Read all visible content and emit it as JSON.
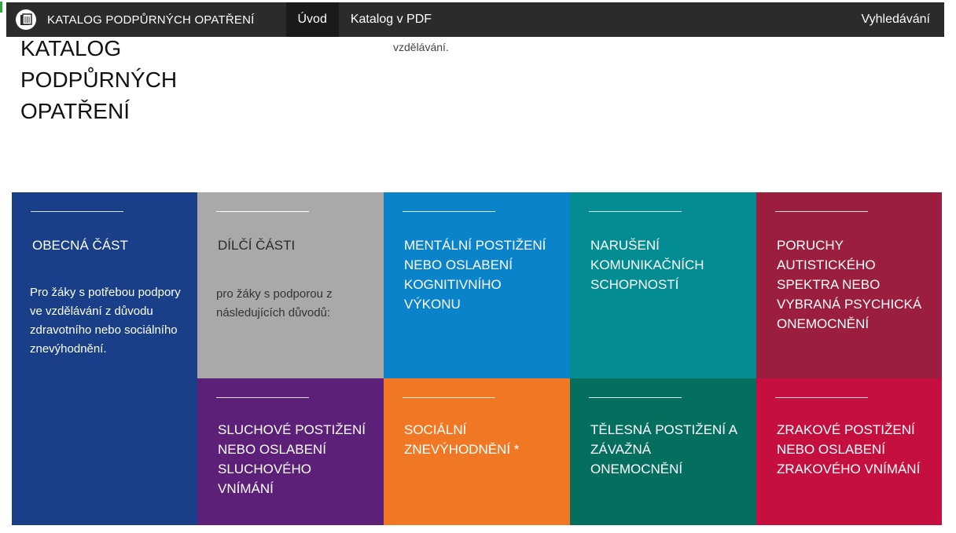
{
  "navbar": {
    "brand_title": "KATALOG PODPŮRNÝCH OPATŘENÍ",
    "brand_icon": "book-icon",
    "items": [
      {
        "label": "Úvod",
        "active": true
      },
      {
        "label": "Katalog v PDF",
        "active": false
      }
    ],
    "search_label": "Vyhledávání"
  },
  "header": {
    "title": "KATALOG PODPŮRNÝCH OPATŘENÍ",
    "intro_fragment": "vzdělávání."
  },
  "tiles": {
    "general": {
      "title": "OBECNÁ ČÁST",
      "description": "Pro žáky s potřebou podpory ve vzdělávání z důvodu zdravotního nebo sociálního znevýhodnění.",
      "color": "#183f87"
    },
    "partial": {
      "title": "DÍLČÍ ČÁSTI",
      "description": "pro žáky s podporou z následujících důvodů:",
      "color": "#a9a9a9"
    },
    "mental": {
      "title": "MENTÁLNÍ POSTIŽENÍ NEBO OSLABENÍ KOGNITIVNÍHO VÝKONU",
      "color": "#0b83cb"
    },
    "communication": {
      "title": "NARUŠENÍ KOMUNIKAČNÍCH SCHOPNOSTÍ",
      "color": "#038d92"
    },
    "autism": {
      "title": "PORUCHY AUTISTICKÉHO SPEKTRA NEBO VYBRANÁ PSYCHICKÁ ONEMOCNĚNÍ",
      "color": "#9b1e3e"
    },
    "hearing": {
      "title": "SLUCHOVÉ POSTIŽENÍ NEBO OSLABENÍ SLUCHOVÉHO VNÍMÁNÍ",
      "color": "#5c2078"
    },
    "social": {
      "title": "SOCIÁLNÍ ZNEVÝHODNĚNÍ *",
      "color": "#f07824"
    },
    "physical": {
      "title": "TĚLESNÁ POSTIŽENÍ A ZÁVAŽNÁ ONEMOCNĚNÍ",
      "color": "#056f5f"
    },
    "visual": {
      "title": "ZRAKOVÉ POSTIŽENÍ NEBO OSLABENÍ ZRAKOVÉHO VNÍMÁNÍ",
      "color": "#c5103f"
    }
  }
}
